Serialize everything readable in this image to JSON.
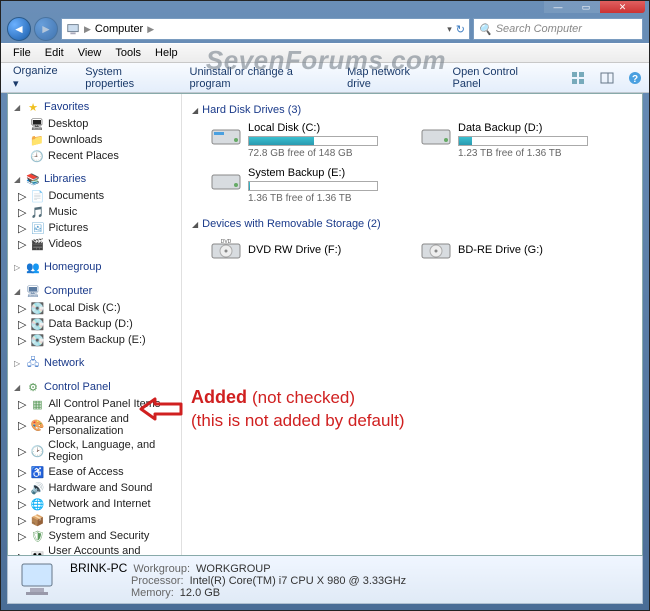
{
  "titlebar": {
    "min": "—",
    "max": "▭",
    "close": "✕"
  },
  "nav": {
    "crumb_root_icon": "computer-icon",
    "crumb_root": "Computer",
    "search_placeholder": "Search Computer"
  },
  "menubar": [
    "File",
    "Edit",
    "View",
    "Tools",
    "Help"
  ],
  "toolbar": {
    "organize": "Organize ▾",
    "sysprop": "System properties",
    "uninstall": "Uninstall or change a program",
    "mapdrive": "Map network drive",
    "opencp": "Open Control Panel"
  },
  "sidebar": {
    "favorites": {
      "header": "Favorites",
      "items": [
        "Desktop",
        "Downloads",
        "Recent Places"
      ]
    },
    "libraries": {
      "header": "Libraries",
      "items": [
        "Documents",
        "Music",
        "Pictures",
        "Videos"
      ]
    },
    "homegroup": {
      "header": "Homegroup"
    },
    "computer": {
      "header": "Computer",
      "items": [
        "Local Disk (C:)",
        "Data Backup (D:)",
        "System Backup (E:)"
      ]
    },
    "network": {
      "header": "Network"
    },
    "controlpanel": {
      "header": "Control Panel",
      "items": [
        "All Control Panel Items",
        "Appearance and Personalization",
        "Clock, Language, and Region",
        "Ease of Access",
        "Hardware and Sound",
        "Network and Internet",
        "Programs",
        "System and Security",
        "User Accounts and Family Safety"
      ]
    }
  },
  "content": {
    "hdd_header": "Hard Disk Drives (3)",
    "drives": [
      {
        "name": "Local Disk (C:)",
        "free": "72.8 GB free of 148 GB",
        "pct": 51
      },
      {
        "name": "Data Backup (D:)",
        "free": "1.23 TB free of 1.36 TB",
        "pct": 10
      },
      {
        "name": "System Backup (E:)",
        "free": "1.36 TB free of 1.36 TB",
        "pct": 1
      }
    ],
    "removable_header": "Devices with Removable Storage (2)",
    "devices": [
      {
        "name": "DVD RW Drive (F:)"
      },
      {
        "name": "BD-RE Drive (G:)"
      }
    ]
  },
  "annotation": {
    "main": "Added",
    "sub1": "(not checked)",
    "sub2": "(this is not added by default)"
  },
  "details": {
    "name": "BRINK-PC",
    "workgroup_lbl": "Workgroup:",
    "workgroup_val": "WORKGROUP",
    "proc_lbl": "Processor:",
    "proc_val": "Intel(R) Core(TM) i7 CPU       X 980  @ 3.33GHz",
    "mem_lbl": "Memory:",
    "mem_val": "12.0 GB"
  },
  "watermark": "SevenForums.com"
}
